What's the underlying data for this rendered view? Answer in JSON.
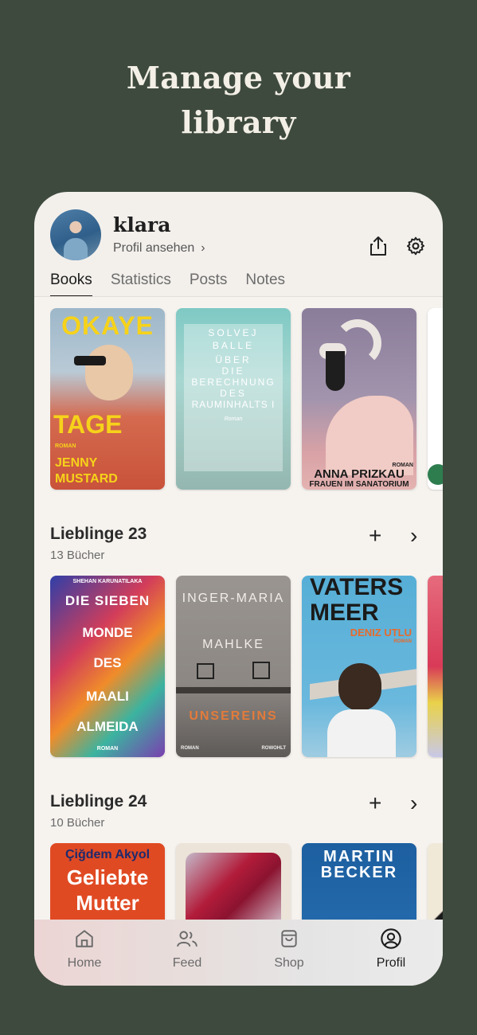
{
  "headline": {
    "line1": "Manage your",
    "line2": "library"
  },
  "profile": {
    "name": "klara",
    "view_link": "Profil ansehen",
    "chevron": "›"
  },
  "tabs": [
    "Books",
    "Statistics",
    "Posts",
    "Notes"
  ],
  "books_row": [
    {
      "title": "OKAYE",
      "title2": "TAGE",
      "author": "JENNY",
      "author2": "MUSTARD",
      "tag": "ROMAN"
    },
    {
      "title": "SOLVEJ",
      "title2": "BALLE",
      "line3": "ÜBER",
      "line4": "DIE",
      "line5": "BERECHNUNG",
      "line6": "DES",
      "line7": "RAUMINHALTS I",
      "tag": "Roman"
    },
    {
      "author": "ANNA PRIZKAU",
      "title": "FRAUEN IM SANATORIUM",
      "tag": "ROMAN"
    }
  ],
  "sections": [
    {
      "title": "Lieblinge 23",
      "count": "13 Bücher",
      "books": [
        {
          "author": "SHEHAN KARUNATILAKA",
          "lines": [
            "DIE SIEBEN",
            "MONDE",
            "DES",
            "MAALI",
            "ALMEIDA"
          ],
          "tag": "ROMAN"
        },
        {
          "author": "INGER-MARIA",
          "author2": "MAHLKE",
          "title": "UNSEREINS",
          "tag": "ROMAN",
          "publisher": "ROWOHLT"
        },
        {
          "title": "VATERS",
          "title2": "MEER",
          "author": "DENIZ UTLU",
          "tag": "ROMAN"
        }
      ]
    },
    {
      "title": "Lieblinge 24",
      "count": "10 Bücher",
      "books": [
        {
          "author": "Çiğdem Akyol",
          "title": "Geliebte",
          "title2": "Mutter"
        },
        {
          "title": ""
        },
        {
          "author": "MARTIN",
          "author2": "BECKER"
        }
      ]
    }
  ],
  "icons": {
    "share": "share-icon",
    "settings": "gear-icon",
    "plus": "+",
    "arrow": "›"
  },
  "nav": [
    {
      "label": "Home",
      "icon": "home-icon"
    },
    {
      "label": "Feed",
      "icon": "people-icon"
    },
    {
      "label": "Shop",
      "icon": "bag-icon"
    },
    {
      "label": "Profil",
      "icon": "profile-icon"
    }
  ],
  "colors": {
    "background": "#3f4a3e",
    "card": "#f3f0ec",
    "text": "#1c1c1c"
  }
}
